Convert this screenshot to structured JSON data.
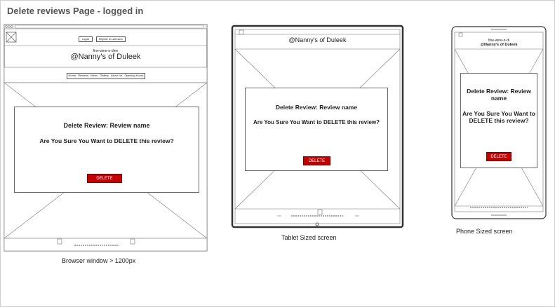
{
  "page": {
    "title": "Delete reviews Page -  logged in"
  },
  "desktop": {
    "caption": "Browser window > 1200px",
    "login_button": "Logout",
    "register_button": "Register an username",
    "site_tagline": "fine-wine-n-dine",
    "site_name": "@Nanny's of Duleek",
    "nav_items": [
      "Home",
      "Reviews",
      "Menu",
      "Gallery",
      "About Us",
      "Opening Hours"
    ],
    "dialog": {
      "heading": "Delete Review: Review name",
      "question": "Are You Sure You Want to DELETE this review?",
      "button": "DELETE"
    }
  },
  "tablet": {
    "caption": "Tablet Sized screen",
    "site_name": "@Nanny's of Duleek",
    "dialog": {
      "heading": "Delete Review: Review name",
      "question": "Are You Sure You Want to DELETE this review?",
      "button": "DELETE"
    }
  },
  "phone": {
    "caption": "Phone Sized screen",
    "site_tagline": "fine-wine-n-di",
    "site_name": "@Nanny's of Duleek",
    "dialog": {
      "heading": "Delete Review: Review name",
      "question": "Are You Sure You Want to DELETE this review?",
      "button": "DELETE"
    }
  },
  "colors": {
    "delete_button": "#c40000",
    "outline": "#555555"
  }
}
